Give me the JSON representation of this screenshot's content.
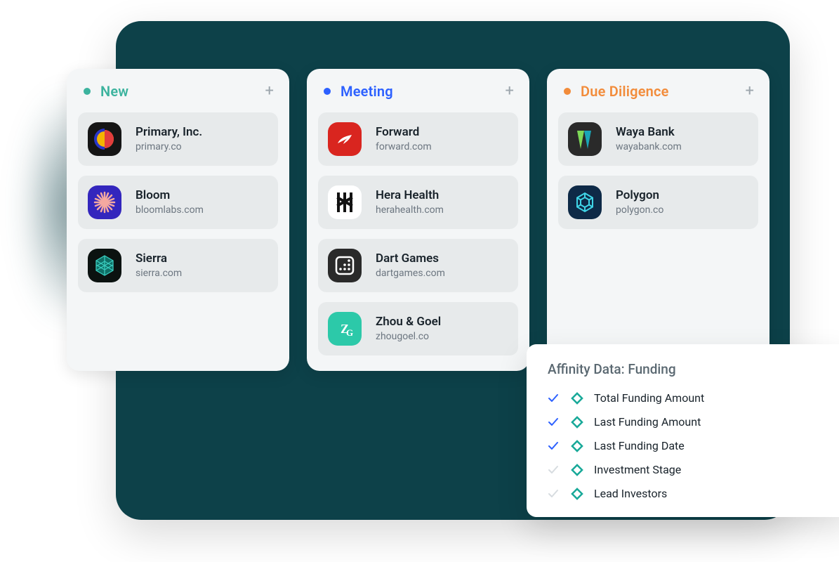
{
  "columns": [
    {
      "title": "New",
      "dotColor": "#3cb39e",
      "titleColor": "#3cb39e",
      "cards": [
        {
          "name": "Primary, Inc.",
          "domain": "primary.co",
          "logo": "primary"
        },
        {
          "name": "Bloom",
          "domain": "bloomlabs.com",
          "logo": "bloom"
        },
        {
          "name": "Sierra",
          "domain": "sierra.com",
          "logo": "sierra"
        }
      ]
    },
    {
      "title": "Meeting",
      "dotColor": "#2c60ff",
      "titleColor": "#2c60ff",
      "cards": [
        {
          "name": "Forward",
          "domain": "forward.com",
          "logo": "forward"
        },
        {
          "name": "Hera Health",
          "domain": "herahealth.com",
          "logo": "hera"
        },
        {
          "name": "Dart Games",
          "domain": "dartgames.com",
          "logo": "dart"
        },
        {
          "name": "Zhou & Goel",
          "domain": "zhougoel.co",
          "logo": "zhou"
        }
      ]
    },
    {
      "title": "Due Diligence",
      "dotColor": "#f28c3b",
      "titleColor": "#f28c3b",
      "cards": [
        {
          "name": "Waya Bank",
          "domain": "wayabank.com",
          "logo": "waya"
        },
        {
          "name": "Polygon",
          "domain": "polygon.co",
          "logo": "polygon"
        }
      ]
    }
  ],
  "affinity": {
    "title": "Affinity Data: Funding",
    "items": [
      {
        "label": "Total Funding Amount",
        "checked": true
      },
      {
        "label": "Last Funding Amount",
        "checked": true
      },
      {
        "label": "Last Funding Date",
        "checked": true
      },
      {
        "label": "Investment Stage",
        "checked": false
      },
      {
        "label": "Lead Investors",
        "checked": false
      }
    ]
  }
}
